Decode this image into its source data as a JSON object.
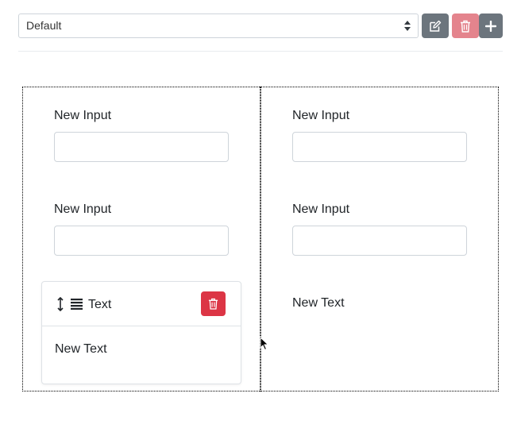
{
  "toolbar": {
    "selected_form": "Default",
    "icons": {
      "caret": "select-caret-icon",
      "edit": "edit-icon",
      "delete": "trash-icon",
      "add": "plus-icon"
    },
    "colors": {
      "secondary": "#6c757d",
      "danger_disabled": "#e4848d",
      "danger": "#dc3545"
    }
  },
  "canvas": {
    "left_column": {
      "fields": [
        {
          "label": "New Input",
          "value": ""
        },
        {
          "label": "New Input",
          "value": ""
        }
      ]
    },
    "right_column": {
      "fields": [
        {
          "label": "New Input",
          "value": ""
        },
        {
          "label": "New Input",
          "value": ""
        }
      ],
      "text": "New Text"
    }
  },
  "drag_card": {
    "title": "Text",
    "body": "New Text"
  }
}
